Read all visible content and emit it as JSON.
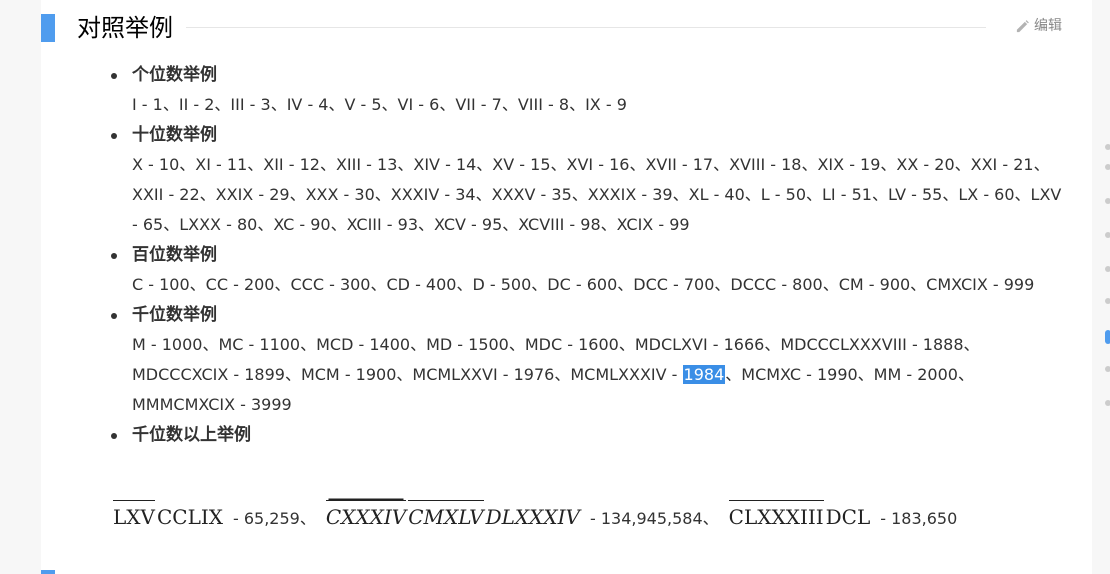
{
  "section": {
    "title": "对照举例",
    "edit_label": "编辑"
  },
  "items": [
    {
      "heading": "个位数举例",
      "text": "I - 1、II - 2、III - 3、IV - 4、V - 5、VI - 6、VII - 7、VIII - 8、IX - 9"
    },
    {
      "heading": "十位数举例",
      "text": "X - 10、XI - 11、XII - 12、XIII - 13、XIV - 14、XV - 15、XVI - 16、XVII - 17、XVIII - 18、XIX - 19、XX - 20、XXI - 21、XXII - 22、XXIX - 29、XXX - 30、XXXIV - 34、XXXV - 35、XXXIX - 39、XL - 40、L - 50、LI - 51、LV - 55、LX - 60、LXV - 65、LXXX - 80、XC - 90、XCIII - 93、XCV - 95、XCVIII - 98、XCIX - 99"
    },
    {
      "heading": "百位数举例",
      "text": "C - 100、CC - 200、CCC - 300、CD - 400、D - 500、DC - 600、DCC - 700、DCCC - 800、CM - 900、CMXCIX - 999"
    },
    {
      "heading": "千位数举例",
      "text_before": "M - 1000、MC - 1100、MCD - 1400、MD - 1500、MDC - 1600、MDCLXVI - 1666、MDCCCLXXXVIII - 1888、MDCCCXCIX - 1899、MCM - 1900、MCMLXXVI - 1976、MCMLXXXIV - ",
      "selected": "1984",
      "text_after": "、MCMXC - 1990、MM - 2000、MMMCMXCIX - 3999"
    },
    {
      "heading": "千位数以上举例"
    }
  ],
  "examples": [
    {
      "parts": [
        {
          "text": "LXV",
          "overline": 1,
          "italic": false
        },
        {
          "text": "CCLIX",
          "overline": 0,
          "italic": false
        }
      ],
      "value": "- 65,259、"
    },
    {
      "parts": [
        {
          "text": "CXXXIV",
          "overline": 2,
          "italic": true
        },
        {
          "text": "CMXLV",
          "overline": 1,
          "italic": true
        },
        {
          "text": "DLXXXIV",
          "overline": 0,
          "italic": true
        }
      ],
      "value": "- 134,945,584、"
    },
    {
      "parts": [
        {
          "text": "CLXXXIII",
          "overline": 1,
          "italic": false
        },
        {
          "text": "DCL",
          "overline": 0,
          "italic": false
        }
      ],
      "value": "- 183,650"
    }
  ],
  "colors": {
    "accent": "#4f9cee",
    "selection": "#3a8ee6",
    "text": "#333333",
    "muted": "#888888"
  },
  "icons": {
    "edit": "pencil-icon"
  }
}
